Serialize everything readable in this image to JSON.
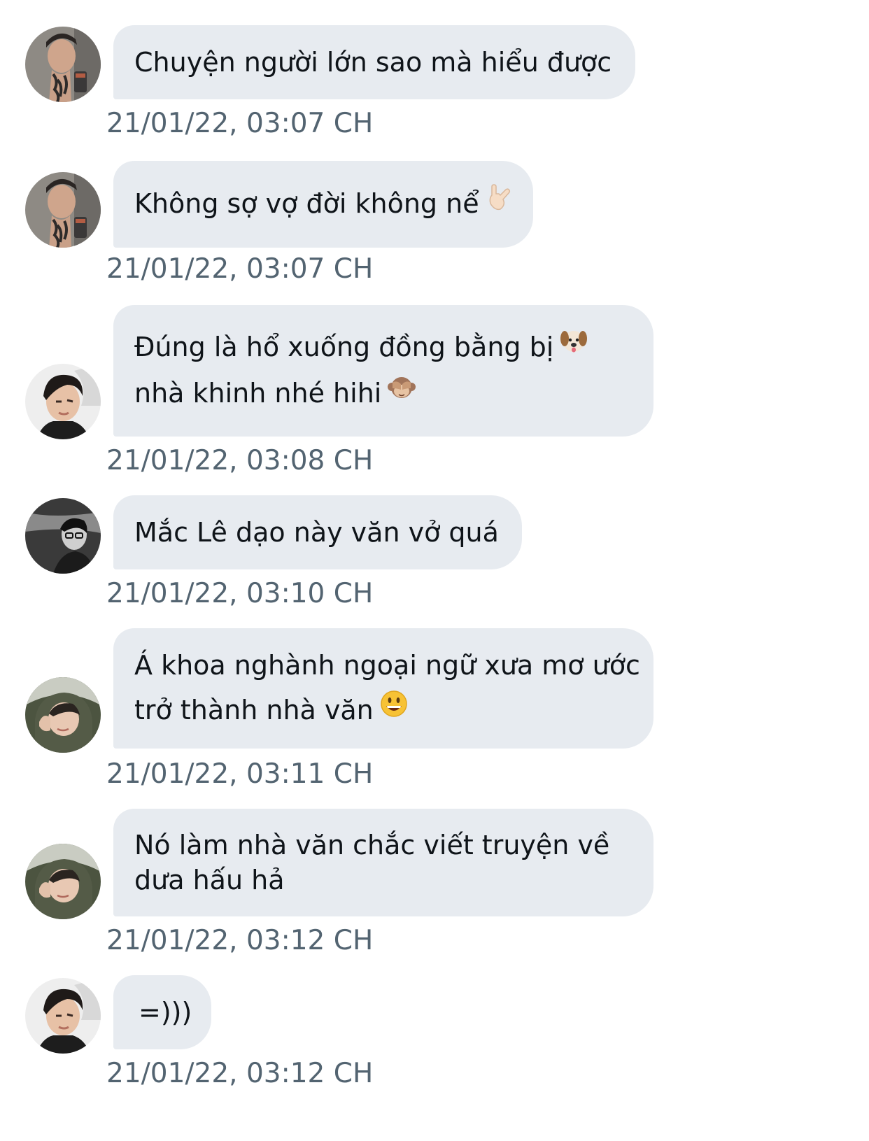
{
  "messages": [
    {
      "lines": [
        "Chuyện người lớn sao mà hiểu được"
      ],
      "time": "21/01/22, 03:07 CH",
      "avatar": "tattooed-man-avatar"
    },
    {
      "lines": [
        "Không sợ vợ đời không nể"
      ],
      "emoji": "sign-of-horns",
      "time": "21/01/22, 03:07 CH",
      "avatar": "tattooed-man-avatar"
    },
    {
      "lines": [
        "Đúng là hổ xuống đồng bằng bị",
        "nhà khinh nhé hihi"
      ],
      "emojis": [
        "dog-face",
        "see-no-evil-monkey"
      ],
      "time": "21/01/22, 03:08 CH",
      "avatar": "young-man-avatar"
    },
    {
      "lines": [
        "Mắc Lê dạo này văn vở quá"
      ],
      "time": "21/01/22, 03:10 CH",
      "avatar": "bw-man-glasses-avatar"
    },
    {
      "lines": [
        "Á khoa nghành ngoại ngữ xưa mơ ước",
        "trở thành nhà văn"
      ],
      "emoji": "grinning-face",
      "time": "21/01/22, 03:11 CH",
      "avatar": "hooded-man-avatar"
    },
    {
      "lines": [
        "Nó làm nhà văn chắc viết truyện về",
        "dưa hấu hả"
      ],
      "time": "21/01/22, 03:12 CH",
      "avatar": "hooded-man-avatar"
    },
    {
      "lines": [
        "=)))"
      ],
      "time": "21/01/22, 03:12 CH",
      "avatar": "young-man-avatar"
    }
  ],
  "colors": {
    "bubble_bg": "#e7ebf0",
    "text": "#0f1419",
    "timestamp": "#536471"
  }
}
